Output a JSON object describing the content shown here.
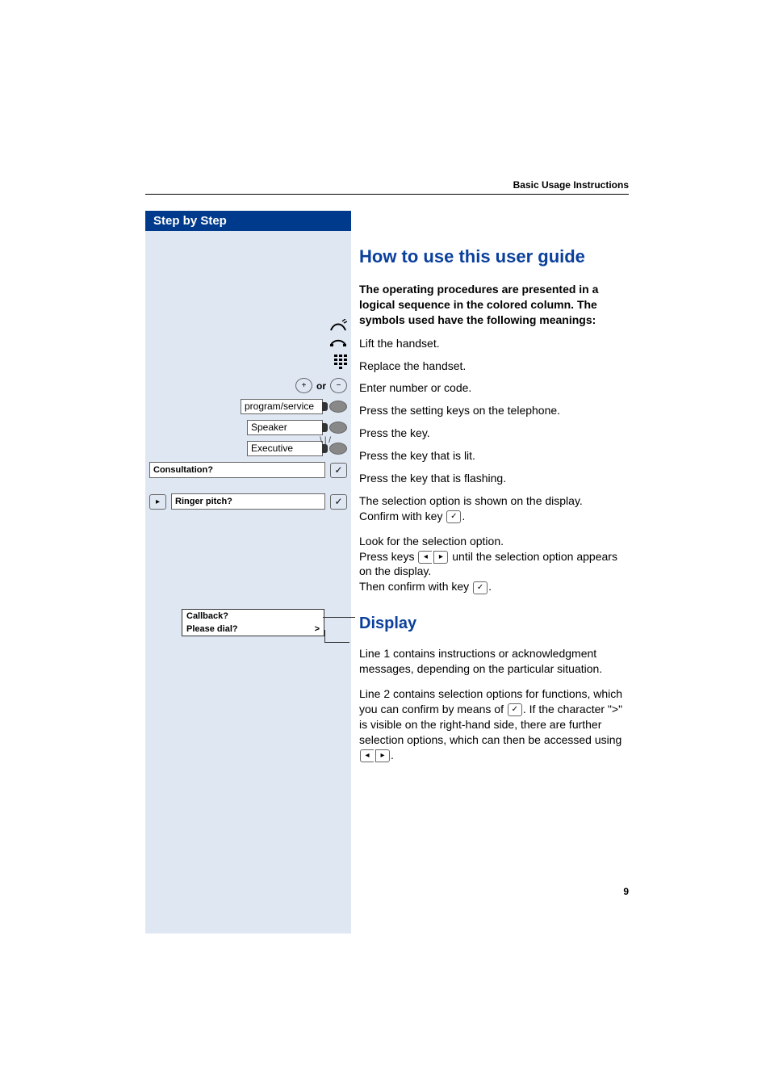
{
  "running_head": "Basic Usage Instructions",
  "page_number": "9",
  "sidebar": {
    "header": "Step by Step",
    "or_word": "or",
    "plus": "+",
    "minus": "−",
    "func1": "program/service",
    "func2": "Speaker",
    "func3": "Executive",
    "prompt1": "Consultation?",
    "prompt2": "Ringer pitch?",
    "display_line1": "Callback?",
    "display_line2": "Please dial?",
    "display_more": ">"
  },
  "main": {
    "h1": "How to use this user guide",
    "intro": "The operating procedures are presented in a logical sequence in the colored column. The symbols used have the following meanings:",
    "l1": "Lift the handset.",
    "l2": "Replace the handset.",
    "l3": "Enter number or code.",
    "l4": "Press the setting keys on the telephone.",
    "l5": "Press the key.",
    "l6": "Press the key that is lit.",
    "l7": "Press the key that is flashing.",
    "l8a": "The selection option is shown on the display.",
    "l8b_pre": "Confirm with key ",
    "l8b_post": ".",
    "l9a": "Look for the selection option.",
    "l9b_pre": "Press keys ",
    "l9b_post": " until the selection option appears on the display.",
    "l9c_pre": "Then confirm with key ",
    "l9c_post": ".",
    "h2": "Display",
    "d1": "Line 1 contains instructions or acknowledgment messages, depending on the particular situation.",
    "d2_pre": "Line 2 contains selection options for functions, which you can confirm by means of ",
    "d2_mid": ". If the character \">\" is visible on the right-hand side, there are further selection options, which can then be accessed using ",
    "d2_post": "."
  }
}
